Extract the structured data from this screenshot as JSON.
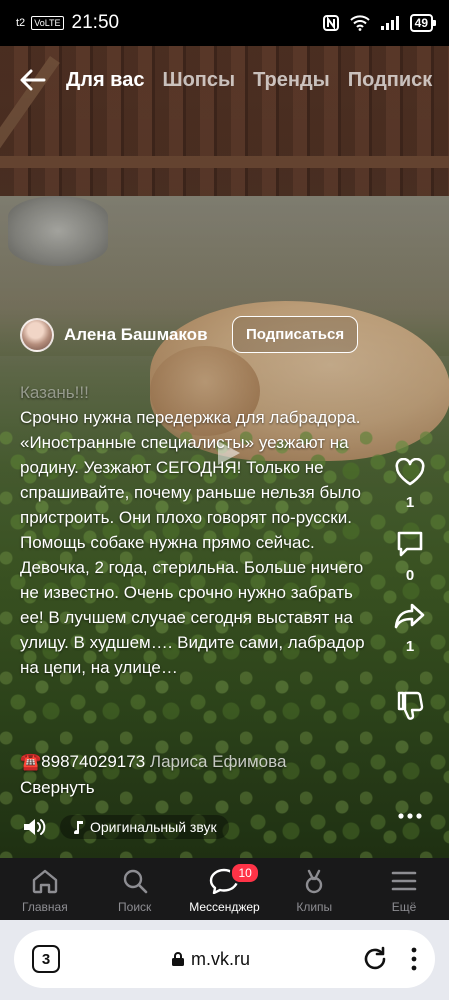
{
  "status_bar": {
    "carrier": "t2",
    "volte": "VoLTE",
    "time": "21:50",
    "battery": "49"
  },
  "top_nav": {
    "tabs": [
      {
        "label": "Для вас",
        "active": true
      },
      {
        "label": "Шопсы",
        "active": false
      },
      {
        "label": "Тренды",
        "active": false
      },
      {
        "label": "Подписк",
        "active": false
      }
    ]
  },
  "post": {
    "author": "Алена Башмаков",
    "subscribe_label": "Подписаться",
    "description_faded": "Казань!!!",
    "description": "Срочно нужна передержка для лабрадора. «Иностранные специалисты» уезжают на родину. Уезжают СЕГОДНЯ! Только не спрашивайте, почему раньше нельзя было пристроить. Они плохо говорят по-русски. Помощь собаке нужна прямо сейчас. Девочка, 2 года, стерильна. Больше ничего не известно. Очень срочно нужно забрать ее! В лучшем случае сегодня выставят на улицу. В худшем…. Видите сами, лабрадор на цепи, на улице…",
    "phone_emoji": "☎️",
    "phone": "89874029173",
    "contact_name": "Лариса Ефимова",
    "collapse_label": "Свернуть",
    "sound_label": "Оригинальный звук"
  },
  "actions": {
    "likes": "1",
    "comments": "0",
    "shares": "1"
  },
  "bottom_nav": {
    "items": [
      {
        "label": "Главная",
        "icon": "home-icon"
      },
      {
        "label": "Поиск",
        "icon": "search-icon"
      },
      {
        "label": "Мессенджер",
        "icon": "messenger-icon",
        "badge": "10",
        "active": true
      },
      {
        "label": "Клипы",
        "icon": "clips-icon"
      },
      {
        "label": "Ещё",
        "icon": "menu-icon"
      }
    ]
  },
  "browser": {
    "tab_count": "3",
    "url": "m.vk.ru"
  },
  "colors": {
    "badge": "#ff3347",
    "nav_bg": "#19191a",
    "browser_bg": "#e7e9ef"
  }
}
